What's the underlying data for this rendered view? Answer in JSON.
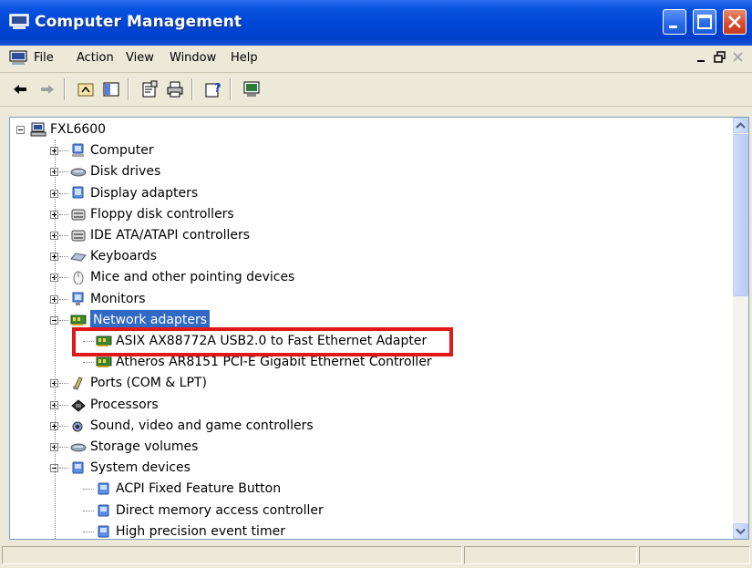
{
  "window": {
    "title": "Computer Management"
  },
  "menu": {
    "items": [
      "File",
      "Action",
      "View",
      "Window",
      "Help"
    ]
  },
  "toolbar": {
    "icons": [
      "back-arrow-icon",
      "forward-arrow-icon",
      "up-folder-icon",
      "show-hide-tree-icon",
      "properties-icon",
      "print-icon",
      "help-icon",
      "console-icon"
    ]
  },
  "tree": {
    "root": "FXL6600",
    "nodes": [
      {
        "label": "Computer",
        "icon": "computer-icon",
        "expanded": false
      },
      {
        "label": "Disk drives",
        "icon": "disk-drive-icon",
        "expanded": false
      },
      {
        "label": "Display adapters",
        "icon": "display-adapter-icon",
        "expanded": false
      },
      {
        "label": "Floppy disk controllers",
        "icon": "controller-icon",
        "expanded": false
      },
      {
        "label": "IDE ATA/ATAPI controllers",
        "icon": "controller-icon",
        "expanded": false
      },
      {
        "label": "Keyboards",
        "icon": "keyboard-icon",
        "expanded": false
      },
      {
        "label": "Mice and other pointing devices",
        "icon": "mouse-icon",
        "expanded": false
      },
      {
        "label": "Monitors",
        "icon": "monitor-icon",
        "expanded": false
      },
      {
        "label": "Network adapters",
        "icon": "network-card-icon",
        "expanded": true,
        "selected": true,
        "children": [
          "ASIX AX88772A USB2.0 to Fast Ethernet Adapter",
          "Atheros AR8151 PCI-E Gigabit Ethernet Controller"
        ]
      },
      {
        "label": "Ports (COM & LPT)",
        "icon": "port-icon",
        "expanded": false
      },
      {
        "label": "Processors",
        "icon": "processor-icon",
        "expanded": false
      },
      {
        "label": "Sound, video and game controllers",
        "icon": "sound-icon",
        "expanded": false
      },
      {
        "label": "Storage volumes",
        "icon": "disk-drive-icon",
        "expanded": false
      },
      {
        "label": "System devices",
        "icon": "system-device-icon",
        "expanded": true,
        "children": [
          "ACPI Fixed Feature Button",
          "Direct memory access controller",
          "High precision event timer"
        ]
      }
    ]
  },
  "highlight": {
    "color": "#e0181a",
    "target": "ASIX AX88772A USB2.0 to Fast Ethernet Adapter"
  },
  "colors": {
    "titlebar": "#0a54e2",
    "selection": "#316ac5",
    "chrome": "#ece9d8"
  }
}
